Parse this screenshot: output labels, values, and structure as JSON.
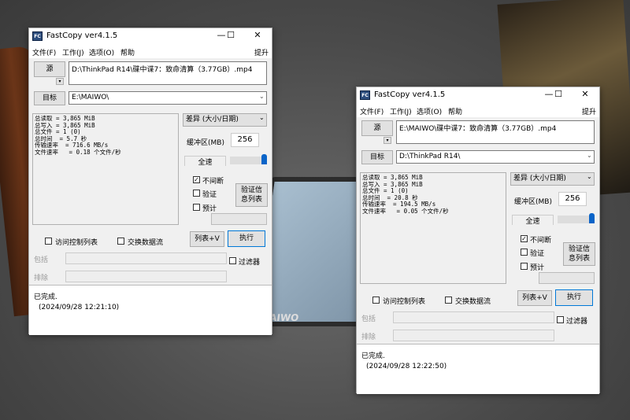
{
  "app": {
    "title": "FastCopy ver4.1.5",
    "menu": [
      "文件(F)",
      "工作(J)",
      "选项(O)",
      "帮助"
    ],
    "upgrade": "提升",
    "app_icon": "FC",
    "source_label": "源",
    "target_label": "目标",
    "buffer_label": "缓冲区(MB)",
    "buffer_value": "256",
    "speed_label": "全速",
    "mode": "差异 (大小/日期)",
    "nonstop": "不间断",
    "verify": "验证",
    "estimate": "预计",
    "verify_list": "验证信息列表",
    "acl": "访问控制列表",
    "ads": "交换数据流",
    "list_btn": "列表+V",
    "exec_btn": "执行",
    "include": "包括",
    "exclude": "排除",
    "filter": "过滤器",
    "done": "已完成.",
    "controls": {
      "minimize": "—",
      "maximize": "☐",
      "close": "✕"
    }
  },
  "windows": [
    {
      "source": "D:\\ThinkPad R14\\碟中谍7：致命清算（3.77GB）.mp4",
      "target": "E:\\MAIWO\\",
      "stats": "总读取 = 3,865 MiB\n总写入 = 3,865 MiB\n总文件 = 1 (0)\n总时间  = 5.7 秒\n传输速率  = 716.6 MB/s\n文件速率   = 0.18 个文件/秒",
      "timestamp": "(2024/09/28 12:21:10)"
    },
    {
      "source": "E:\\MAIWO\\碟中谍7：致命清算（3.77GB）.mp4",
      "target": "D:\\ThinkPad R14\\",
      "stats": "总读取 = 3,865 MiB\n总写入 = 3,865 MiB\n总文件 = 1 (0)\n总时间  = 20.8 秒\n传输速率  = 194.5 MB/s\n文件速率   = 0.05 个文件/秒",
      "timestamp": "(2024/09/28 12:22:50)"
    }
  ],
  "background": {
    "device_logo": "MAIWO"
  }
}
